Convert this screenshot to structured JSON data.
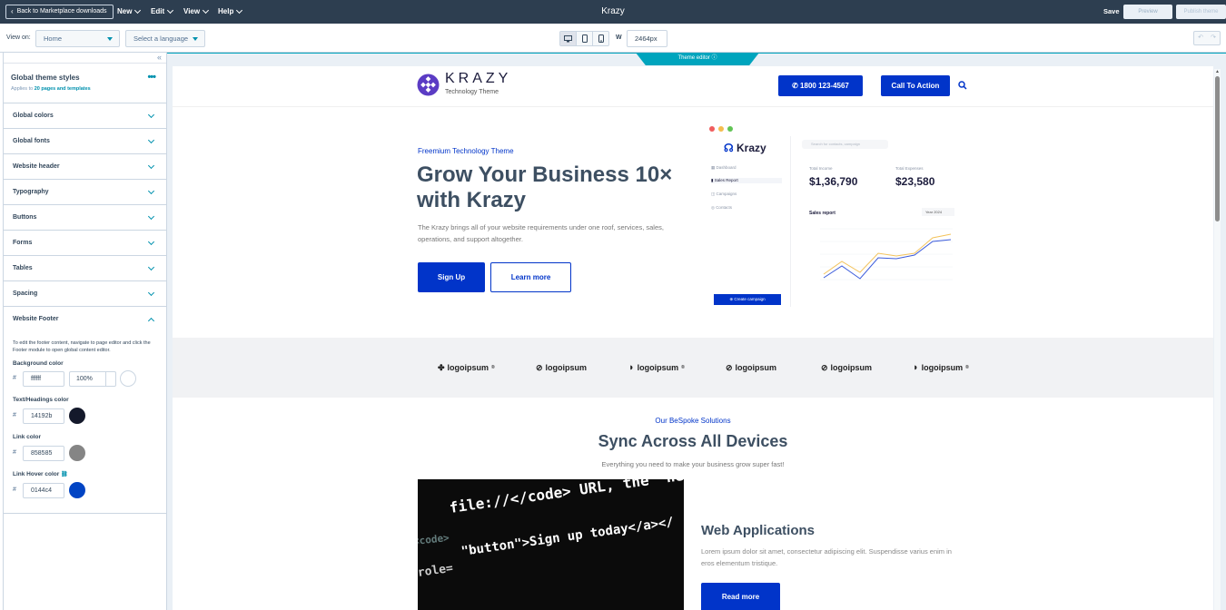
{
  "topbar": {
    "back_label": "Back to Marketplace downloads",
    "menus": [
      {
        "label": "New"
      },
      {
        "label": "Edit"
      },
      {
        "label": "View"
      },
      {
        "label": "Help"
      }
    ],
    "title": "Krazy",
    "save_label": "Save",
    "preview_label": "Preview",
    "publish_label": "Publish theme"
  },
  "toolbar": {
    "view_on_label": "View on:",
    "page_select": "Home",
    "language_select": "Select a language",
    "width_label": "W",
    "width_value": "2464px"
  },
  "sidebar": {
    "title": "Global theme styles",
    "applies_prefix": "Applies to ",
    "applies_link": "20 pages and templates",
    "sections": [
      {
        "label": "Global colors"
      },
      {
        "label": "Global fonts"
      },
      {
        "label": "Website header"
      },
      {
        "label": "Typography"
      },
      {
        "label": "Buttons"
      },
      {
        "label": "Forms"
      },
      {
        "label": "Tables"
      },
      {
        "label": "Spacing"
      }
    ],
    "footer_section": {
      "label": "Website Footer",
      "note": "To edit the footer content, navigate to page editor and click the Footer module to open global content editor.",
      "background_label": "Background color",
      "background_hex": "ffffff",
      "background_opacity": "100%",
      "text_label": "Text/Headings color",
      "text_hex": "14192b",
      "link_label": "Link color",
      "link_hex": "858585",
      "hover_label": "Link Hover color",
      "hover_hex": "0144c4",
      "hash": "#"
    }
  },
  "canvas": {
    "theme_editor_label": "Theme editor",
    "site": {
      "logo_text": "KRAZY",
      "logo_sub": "Technology Theme",
      "phone_label": "1800 123-4567",
      "cta_label": "Call To Action",
      "hero": {
        "eyebrow": "Freemium Technology Theme",
        "title": "Grow Your Business 10× with Krazy",
        "desc": "The Krazy brings all of your website requirements under one roof, services, sales, operations, and support altogether.",
        "signup": "Sign Up",
        "learn": "Learn more"
      },
      "dashboard": {
        "logo": "Krazy",
        "search": "Search for contacts, campaign",
        "nav": [
          "Dashboard",
          "Sales Report",
          "Campaigns",
          "Contacts"
        ],
        "stat1_label": "Total Income",
        "stat1_value": "$1,36,790",
        "stat2_label": "Total Expenses",
        "stat2_value": "$23,580",
        "report_title": "Sales report",
        "year": "Year 2024",
        "create": "Create campaign"
      },
      "logos": [
        "logoipsum",
        "logoipsum",
        "logoipsum",
        "logoipsum",
        "logoipsum",
        "logoipsum"
      ],
      "solutions": {
        "eyebrow": "Our BeSpoke Solutions",
        "title": "Sync Across All Devices",
        "sub": "Everything you need to make your business grow super fast!"
      },
      "webapp": {
        "title": "Web Applications",
        "desc": "Lorem ipsum dolor sit amet, consectetur adipiscing elit. Suspendisse varius enim in eros elementum tristique.",
        "btn": "Read more"
      },
      "code_lines": [
        "file://</code> URL, the \"next\"",
        "<code>",
        "\"button\">Sign up today</a></",
        "role="
      ]
    }
  },
  "colors": {
    "topbar": "#2d3e50",
    "accent": "#00a4bd",
    "brand_blue": "#0134c9",
    "text_dark": "#14192b",
    "link_gray": "#858585",
    "hover_blue": "#0144c4"
  }
}
